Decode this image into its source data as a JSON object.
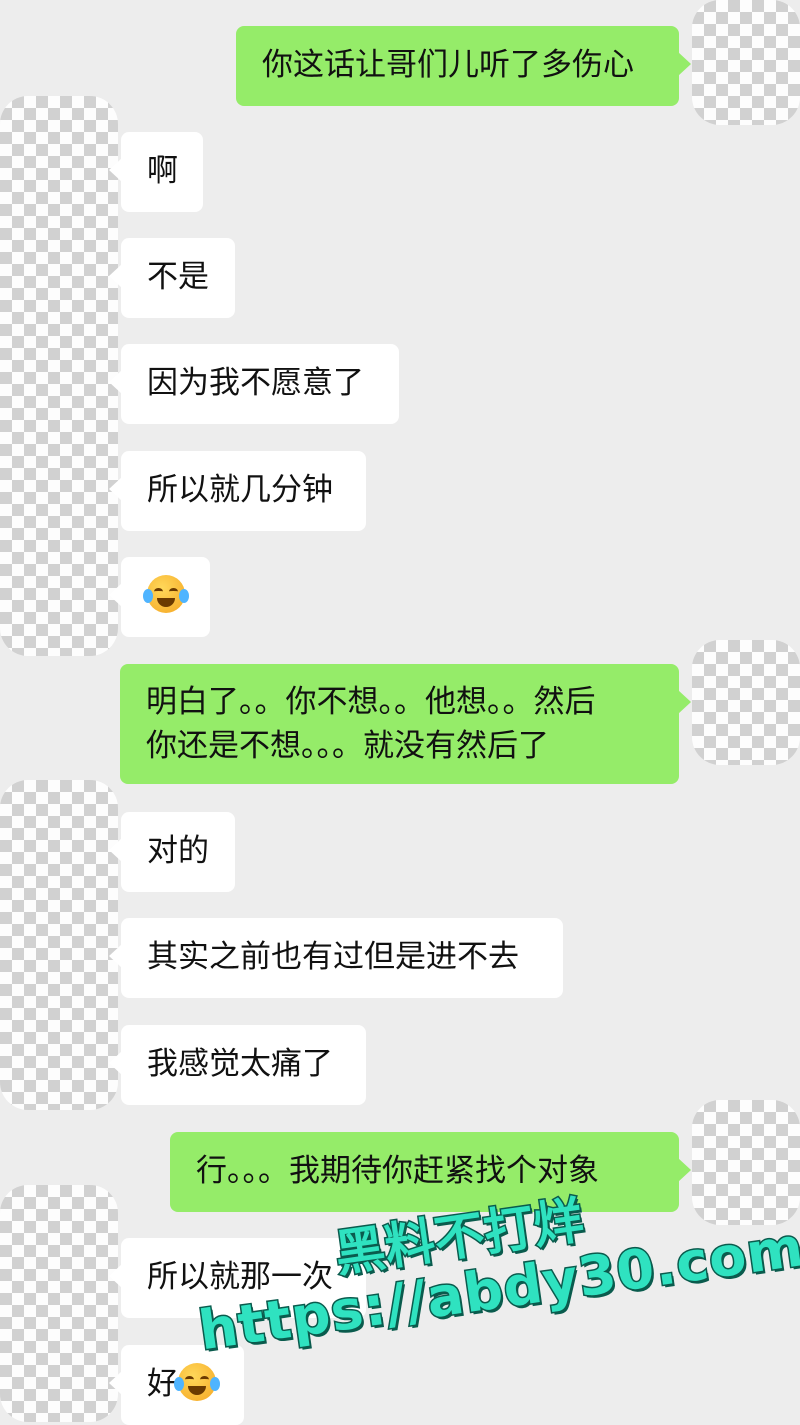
{
  "messages": [
    {
      "side": "out",
      "text": "你这话让哥们儿听了多伤心"
    },
    {
      "side": "in",
      "text": "啊"
    },
    {
      "side": "in",
      "text": "不是"
    },
    {
      "side": "in",
      "text": "因为我不愿意了"
    },
    {
      "side": "in",
      "text": "所以就几分钟"
    },
    {
      "side": "in",
      "text": "",
      "emoji": "face-with-tears-of-joy-icon"
    },
    {
      "side": "out",
      "line1": "明白了。。你不想。。他想。。然后",
      "line2": "你还是不想。。。就没有然后了"
    },
    {
      "side": "in",
      "text": "对的"
    },
    {
      "side": "in",
      "text": "其实之前也有过但是进不去"
    },
    {
      "side": "in",
      "text": "我感觉太痛了"
    },
    {
      "side": "out",
      "text": "行。。。我期待你赶紧找个对象"
    },
    {
      "side": "in",
      "text": "所以就那一次"
    },
    {
      "side": "in",
      "text": "好",
      "emoji": "face-with-tears-of-joy-icon"
    }
  ],
  "watermark": {
    "line1": "黑料不打烊",
    "line2": "https://abdy30.com"
  },
  "colors": {
    "background": "#ededed",
    "incoming": "#ffffff",
    "outgoing": "#95ec69",
    "watermark": "#2fe2c0"
  }
}
